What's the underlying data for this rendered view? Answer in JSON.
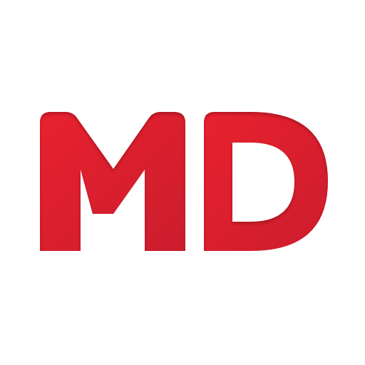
{
  "logo": {
    "text": "MD",
    "colors": {
      "primary": "#e8202e",
      "secondary": "#cc1f2d",
      "background": "#ffffff"
    }
  }
}
